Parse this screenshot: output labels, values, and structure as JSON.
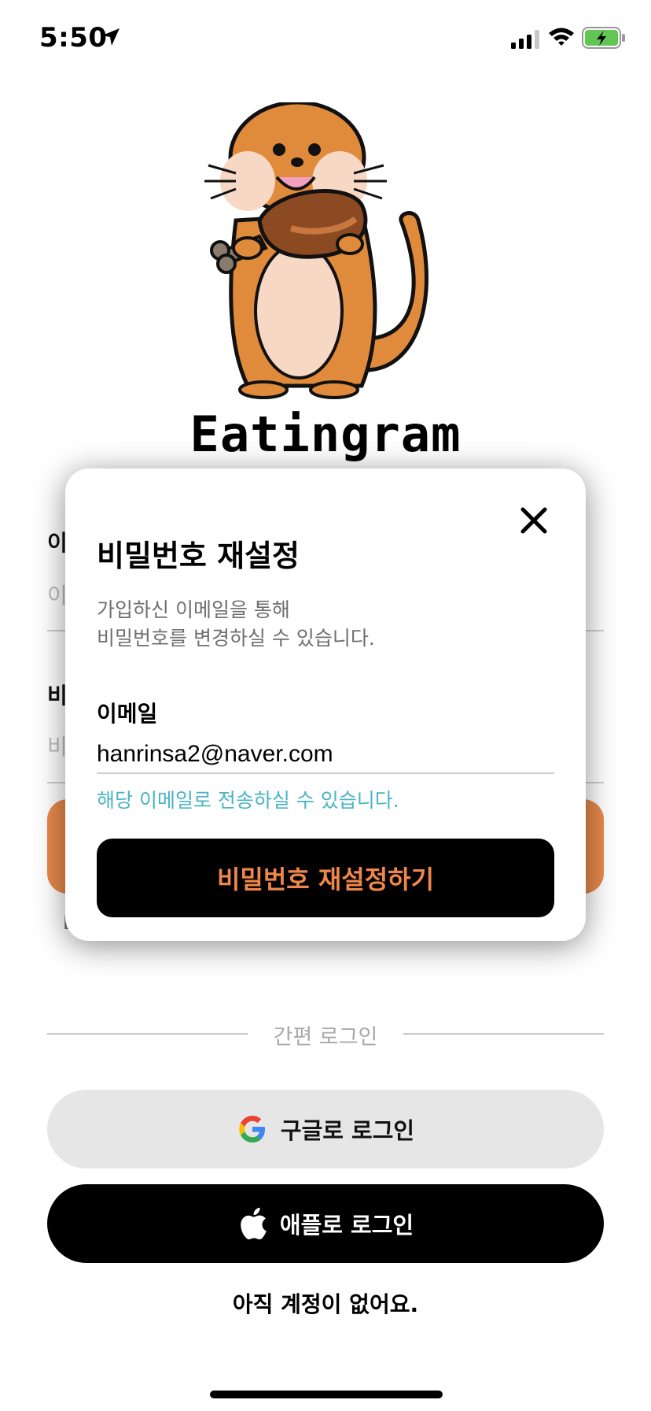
{
  "status_bar": {
    "time": "5:50",
    "icons": [
      "location-arrow-icon",
      "cellular-signal-icon",
      "wifi-icon",
      "battery-charging-icon"
    ],
    "battery_color": "#62c554"
  },
  "app": {
    "title": "Eatingram"
  },
  "login_form": {
    "email_label": "이",
    "email_placeholder": "이",
    "password_label": "비",
    "password_placeholder": "비",
    "login_button_color": "#e88a4c",
    "stray_text": "L"
  },
  "reset_modal": {
    "title": "비밀번호 재설정",
    "description_line1": "가입하신 이메일을 통해",
    "description_line2": "비밀번호를 변경하실 수 있습니다.",
    "email_label": "이메일",
    "email_value": "hanrinsa2@naver.com",
    "email_hint": "해당 이메일로 전송하실 수 있습니다.",
    "submit_label": "비밀번호 재설정하기",
    "close_icon": "close-icon",
    "accent_color": "#f0874a",
    "hint_color": "#4bb3c4"
  },
  "social_login": {
    "divider_label": "간편 로그인",
    "google_label": "구글로 로그인",
    "apple_label": "애플로 로그인"
  },
  "signup": {
    "label": "아직 계정이 없어요."
  }
}
